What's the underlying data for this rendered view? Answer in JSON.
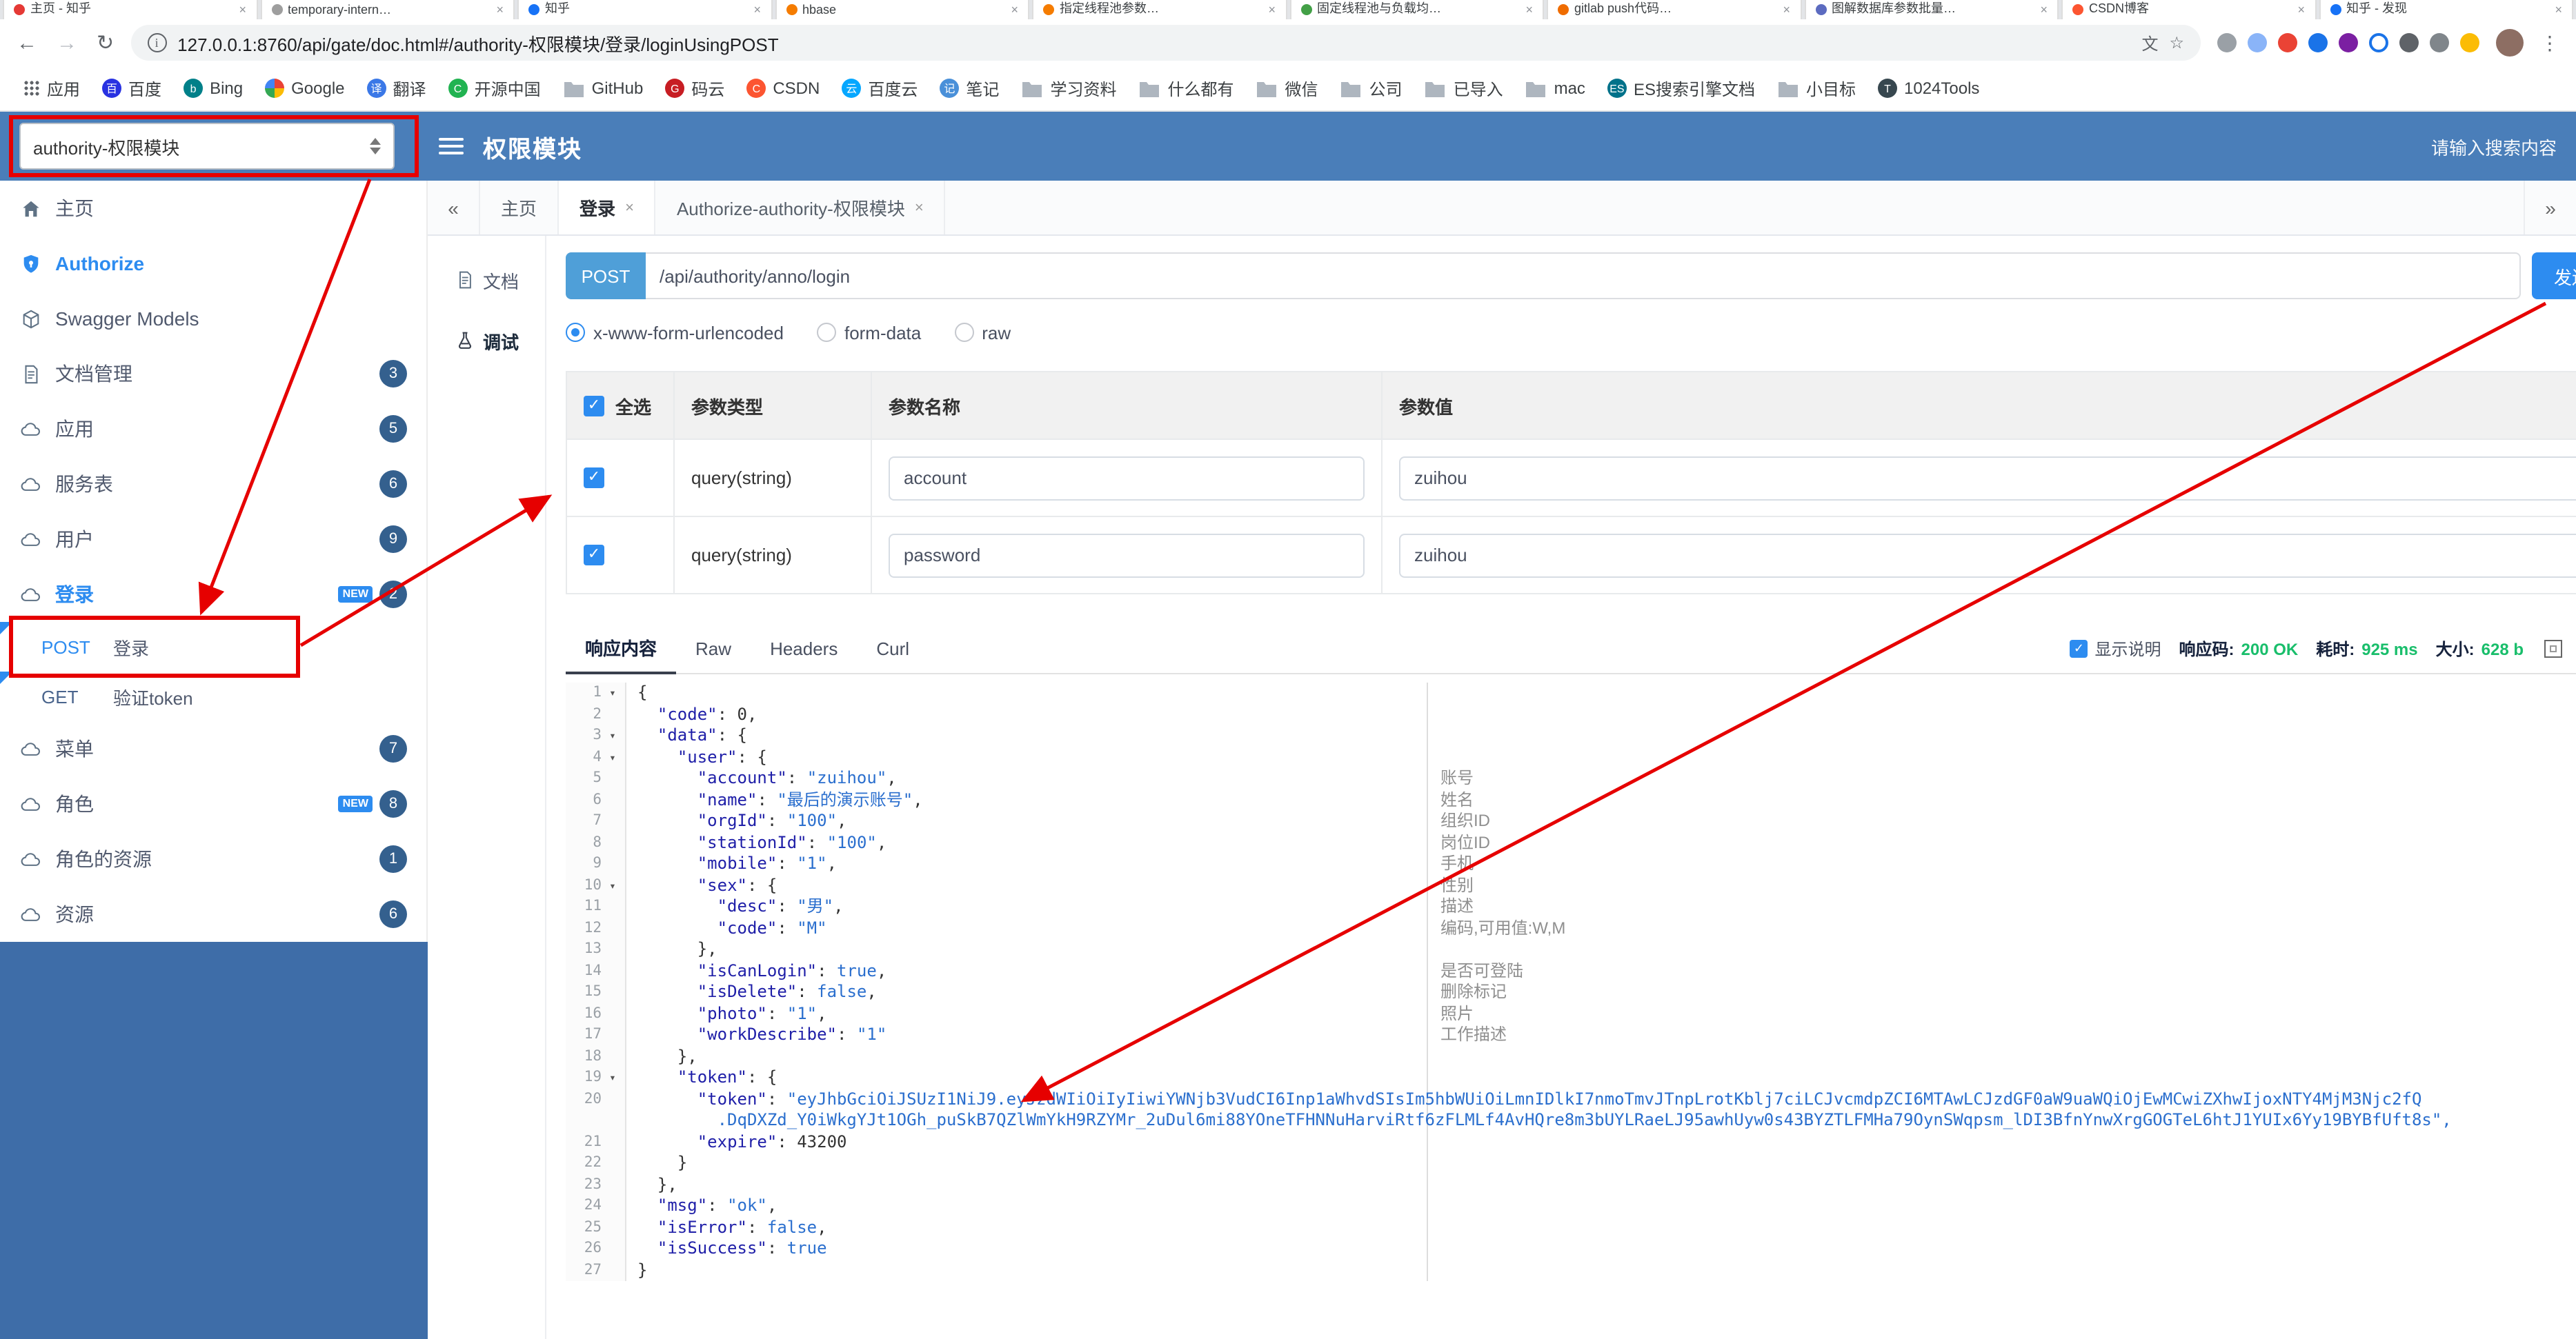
{
  "browser": {
    "tabs": [
      {
        "title": "主页 - 知乎",
        "fav": "#e53935"
      },
      {
        "title": "temporary-intern…",
        "fav": "#9e9e9e"
      },
      {
        "title": "知乎",
        "fav": "#1772f6"
      },
      {
        "title": "hbase",
        "fav": "#f57c00"
      },
      {
        "title": "指定线程池参数…",
        "fav": "#f57c00"
      },
      {
        "title": "固定线程池与负载均…",
        "fav": "#43a047"
      },
      {
        "title": "gitlab push代码…",
        "fav": "#ef6c00"
      },
      {
        "title": "图解数据库参数批量…",
        "fav": "#5c6bc0"
      },
      {
        "title": "CSDN博客",
        "fav": "#fc5531"
      },
      {
        "title": "知乎 - 发现",
        "fav": "#1772f6"
      }
    ],
    "nav_icons": [
      {
        "name": "back-icon",
        "glyph": "←",
        "dim": false
      },
      {
        "name": "forward-icon",
        "glyph": "→",
        "dim": true
      },
      {
        "name": "reload-icon",
        "glyph": "↻",
        "dim": false
      }
    ],
    "address": {
      "url": "127.0.0.1:8760/api/gate/doc.html#/authority-权限模块/登录/loginUsingPOST"
    },
    "pill_icons": {
      "info": "i",
      "translate": "文",
      "star": "☆"
    },
    "menu_icon": "⋮",
    "extensions": [
      {
        "name": "capture-extension-icon",
        "color": "#9aa0a6"
      },
      {
        "name": "notes-extension-icon",
        "color": "#8ab4f8"
      },
      {
        "name": "google-extension-icon",
        "color": "#ea4335"
      },
      {
        "name": "blue-extension-icon",
        "color": "#1a73e8"
      },
      {
        "name": "purple-extension-icon",
        "color": "#7b1fa2"
      },
      {
        "name": "ring-extension-icon",
        "color": "#ffffff",
        "ring": true
      },
      {
        "name": "shield-extension-icon",
        "color": "#5f6368"
      },
      {
        "name": "tool-extension-icon",
        "color": "#80868b"
      },
      {
        "name": "pinwheel-extension-icon",
        "color": "#fbbc05"
      }
    ],
    "bookmarks": [
      {
        "label": "应用",
        "icon": "grid"
      },
      {
        "label": "百度",
        "icon": "circle",
        "color": "#2932e1",
        "letter": "百"
      },
      {
        "label": "Bing",
        "icon": "circle",
        "color": "#008089",
        "letter": "b"
      },
      {
        "label": "Google",
        "icon": "google"
      },
      {
        "label": "翻译",
        "icon": "circle",
        "color": "#3b78e7",
        "letter": "译"
      },
      {
        "label": "开源中国",
        "icon": "circle",
        "color": "#21b351",
        "letter": "C"
      },
      {
        "label": "GitHub",
        "icon": "folder"
      },
      {
        "label": "码云",
        "icon": "circle",
        "color": "#c71d23",
        "letter": "G"
      },
      {
        "label": "CSDN",
        "icon": "circle",
        "color": "#fc5531",
        "letter": "C"
      },
      {
        "label": "百度云",
        "icon": "circle",
        "color": "#06a7ff",
        "letter": "云"
      },
      {
        "label": "笔记",
        "icon": "circle",
        "color": "#4a90d9",
        "letter": "记"
      },
      {
        "label": "学习资料",
        "icon": "folder"
      },
      {
        "label": "什么都有",
        "icon": "folder"
      },
      {
        "label": "微信",
        "icon": "folder"
      },
      {
        "label": "公司",
        "icon": "folder"
      },
      {
        "label": "已导入",
        "icon": "folder"
      },
      {
        "label": "mac",
        "icon": "folder"
      },
      {
        "label": "ES搜索引擎文档",
        "icon": "circle",
        "color": "#00728a",
        "letter": "ES"
      },
      {
        "label": "小目标",
        "icon": "folder"
      },
      {
        "label": "1024Tools",
        "icon": "circle",
        "color": "#37474f",
        "letter": "T"
      }
    ]
  },
  "header": {
    "project_select": "authority-权限模块",
    "title": "权限模块",
    "search_text": "请输入搜索内容"
  },
  "sidebar": {
    "items": [
      {
        "kind": "item",
        "icon": "home",
        "label": "主页"
      },
      {
        "kind": "item",
        "icon": "shield",
        "label": "Authorize",
        "accent": true
      },
      {
        "kind": "item",
        "icon": "cube",
        "label": "Swagger Models"
      },
      {
        "kind": "item",
        "icon": "docs",
        "label": "文档管理",
        "badge": "3"
      },
      {
        "kind": "item",
        "icon": "cloud",
        "label": "应用",
        "badge": "5"
      },
      {
        "kind": "item",
        "icon": "cloud",
        "label": "服务表",
        "badge": "6"
      },
      {
        "kind": "item",
        "icon": "cloud",
        "label": "用户",
        "badge": "9"
      },
      {
        "kind": "item",
        "icon": "cloud",
        "label": "登录",
        "badge": "2",
        "new": true,
        "accent": true
      },
      {
        "kind": "op",
        "method": "POST",
        "label": "登录",
        "highlight": true
      },
      {
        "kind": "op",
        "method": "GET",
        "label": "验证token"
      },
      {
        "kind": "item",
        "icon": "cloud",
        "label": "菜单",
        "badge": "7"
      },
      {
        "kind": "item",
        "icon": "cloud",
        "label": "角色",
        "badge": "8",
        "new": true
      },
      {
        "kind": "item",
        "icon": "cloud",
        "label": "角色的资源",
        "badge": "1"
      },
      {
        "kind": "item",
        "icon": "cloud",
        "label": "资源",
        "badge": "6"
      }
    ]
  },
  "main_tabs": {
    "scroll_left": "«",
    "scroll_right": "»",
    "close_glyph": "×",
    "items": [
      {
        "label": "主页",
        "closable": false,
        "active": false
      },
      {
        "label": "登录",
        "closable": true,
        "active": true
      },
      {
        "label": "Authorize-authority-权限模块",
        "closable": true,
        "active": false
      }
    ]
  },
  "doc_nav": {
    "items": [
      {
        "label": "文档",
        "icon": "doc",
        "active": false
      },
      {
        "label": "调试",
        "icon": "debug",
        "active": true
      }
    ]
  },
  "request": {
    "method": "POST",
    "path": "/api/authority/anno/login",
    "send_label": "发送",
    "body_types": [
      "x-www-form-urlencoded",
      "form-data",
      "raw"
    ],
    "selected_body_type": "x-www-form-urlencoded"
  },
  "params_table": {
    "select_all_label": "全选",
    "headers": [
      "参数类型",
      "参数名称",
      "参数值"
    ],
    "rows": [
      {
        "checked": true,
        "type": "query(string)",
        "name": "account",
        "value": "zuihou"
      },
      {
        "checked": true,
        "type": "query(string)",
        "name": "password",
        "value": "zuihou"
      }
    ]
  },
  "response": {
    "tabs": [
      "响应内容",
      "Raw",
      "Headers",
      "Curl"
    ],
    "active_tab": "响应内容",
    "show_desc_label": "显示说明",
    "meta": {
      "code_label": "响应码:",
      "code_value": "200 OK",
      "time_label": "耗时:",
      "time_value": "925 ms",
      "size_label": "大小:",
      "size_value": "628 b"
    }
  },
  "response_body": {
    "lines": [
      {
        "n": 1,
        "fold": true,
        "ind": 0,
        "toks": [
          [
            "p",
            "{"
          ]
        ]
      },
      {
        "n": 2,
        "ind": 1,
        "toks": [
          [
            "k",
            "\"code\""
          ],
          [
            "p",
            ": "
          ],
          [
            "num",
            "0"
          ],
          [
            "p",
            ","
          ]
        ]
      },
      {
        "n": 3,
        "fold": true,
        "ind": 1,
        "toks": [
          [
            "k",
            "\"data\""
          ],
          [
            "p",
            ": {"
          ]
        ]
      },
      {
        "n": 4,
        "fold": true,
        "ind": 2,
        "toks": [
          [
            "k",
            "\"user\""
          ],
          [
            "p",
            ": {"
          ]
        ]
      },
      {
        "n": 5,
        "ind": 3,
        "toks": [
          [
            "k",
            "\"account\""
          ],
          [
            "p",
            ": "
          ],
          [
            "s",
            "\"zuihou\""
          ],
          [
            "p",
            ","
          ]
        ],
        "ann": "账号"
      },
      {
        "n": 6,
        "ind": 3,
        "toks": [
          [
            "k",
            "\"name\""
          ],
          [
            "p",
            ": "
          ],
          [
            "s",
            "\"最后的演示账号\""
          ],
          [
            "p",
            ","
          ]
        ],
        "ann": "姓名"
      },
      {
        "n": 7,
        "ind": 3,
        "toks": [
          [
            "k",
            "\"orgId\""
          ],
          [
            "p",
            ": "
          ],
          [
            "s",
            "\"100\""
          ],
          [
            "p",
            ","
          ]
        ],
        "ann": "组织ID"
      },
      {
        "n": 8,
        "ind": 3,
        "toks": [
          [
            "k",
            "\"stationId\""
          ],
          [
            "p",
            ": "
          ],
          [
            "s",
            "\"100\""
          ],
          [
            "p",
            ","
          ]
        ],
        "ann": "岗位ID"
      },
      {
        "n": 9,
        "ind": 3,
        "toks": [
          [
            "k",
            "\"mobile\""
          ],
          [
            "p",
            ": "
          ],
          [
            "s",
            "\"1\""
          ],
          [
            "p",
            ","
          ]
        ],
        "ann": "手机"
      },
      {
        "n": 10,
        "fold": true,
        "ind": 3,
        "toks": [
          [
            "k",
            "\"sex\""
          ],
          [
            "p",
            ": {"
          ]
        ],
        "ann": "性别"
      },
      {
        "n": 11,
        "ind": 4,
        "toks": [
          [
            "k",
            "\"desc\""
          ],
          [
            "p",
            ": "
          ],
          [
            "s",
            "\"男\""
          ],
          [
            "p",
            ","
          ]
        ],
        "ann": "描述"
      },
      {
        "n": 12,
        "ind": 4,
        "toks": [
          [
            "k",
            "\"code\""
          ],
          [
            "p",
            ": "
          ],
          [
            "s",
            "\"M\""
          ]
        ],
        "ann": "编码,可用值:W,M"
      },
      {
        "n": 13,
        "ind": 3,
        "toks": [
          [
            "p",
            "},"
          ]
        ]
      },
      {
        "n": 14,
        "ind": 3,
        "toks": [
          [
            "k",
            "\"isCanLogin\""
          ],
          [
            "p",
            ": "
          ],
          [
            "b",
            "true"
          ],
          [
            "p",
            ","
          ]
        ],
        "ann": "是否可登陆"
      },
      {
        "n": 15,
        "ind": 3,
        "toks": [
          [
            "k",
            "\"isDelete\""
          ],
          [
            "p",
            ": "
          ],
          [
            "b",
            "false"
          ],
          [
            "p",
            ","
          ]
        ],
        "ann": "删除标记"
      },
      {
        "n": 16,
        "ind": 3,
        "toks": [
          [
            "k",
            "\"photo\""
          ],
          [
            "p",
            ": "
          ],
          [
            "s",
            "\"1\""
          ],
          [
            "p",
            ","
          ]
        ],
        "ann": "照片"
      },
      {
        "n": 17,
        "ind": 3,
        "toks": [
          [
            "k",
            "\"workDescribe\""
          ],
          [
            "p",
            ": "
          ],
          [
            "s",
            "\"1\""
          ]
        ],
        "ann": "工作描述"
      },
      {
        "n": 18,
        "ind": 2,
        "toks": [
          [
            "p",
            "},"
          ]
        ]
      },
      {
        "n": 19,
        "fold": true,
        "ind": 2,
        "toks": [
          [
            "k",
            "\"token\""
          ],
          [
            "p",
            ": {"
          ]
        ]
      },
      {
        "n": 20,
        "ind": 3,
        "toks": [
          [
            "k",
            "\"token\""
          ],
          [
            "p",
            ": "
          ],
          [
            "s",
            "\"eyJhbGciOiJSUzI1NiJ9.eyJzdWIiOiIyIiwiYWNjb3VudCI6Inp1aWhvdSIsIm5hbWUiOiLmnIDlkI7nmoTmvJTnpLrotKblj7ciLCJvcmdpZCI6MTAwLCJzdGF0aW9uaWQiOjEwMCwiZXhwIjoxNTY4MjM3Njc2fQ"
          ]
        ],
        "cont": {
          "ind": 4,
          "toks": [
            [
              "s",
              ".DqDXZd_Y0iWkgYJt1OGh_puSkB7QZlWmYkH9RZYMr_2uDul6mi88YOneTFHNNuHarviRtf6zFLMLf4AvHQre8m3bUYLRaeLJ95awhUyw0s43BYZTLFMHa79OynSWqpsm_lDI3BfnYnwXrgGOGTeL6htJ1YUIx6Yy19BYBfUft8s\","
            ]
          ]
        }
      },
      {
        "n": 21,
        "ind": 3,
        "toks": [
          [
            "k",
            "\"expire\""
          ],
          [
            "p",
            ": "
          ],
          [
            "num",
            "43200"
          ]
        ]
      },
      {
        "n": 22,
        "ind": 2,
        "toks": [
          [
            "p",
            "}"
          ]
        ]
      },
      {
        "n": 23,
        "ind": 1,
        "toks": [
          [
            "p",
            "},"
          ]
        ]
      },
      {
        "n": 24,
        "ind": 1,
        "toks": [
          [
            "k",
            "\"msg\""
          ],
          [
            "p",
            ": "
          ],
          [
            "s",
            "\"ok\""
          ],
          [
            "p",
            ","
          ]
        ]
      },
      {
        "n": 25,
        "ind": 1,
        "toks": [
          [
            "k",
            "\"isError\""
          ],
          [
            "p",
            ": "
          ],
          [
            "b",
            "false"
          ],
          [
            "p",
            ","
          ]
        ]
      },
      {
        "n": 26,
        "ind": 1,
        "toks": [
          [
            "k",
            "\"isSuccess\""
          ],
          [
            "p",
            ": "
          ],
          [
            "b",
            "true"
          ]
        ]
      },
      {
        "n": 27,
        "ind": 0,
        "toks": [
          [
            "p",
            "}"
          ]
        ]
      }
    ]
  }
}
